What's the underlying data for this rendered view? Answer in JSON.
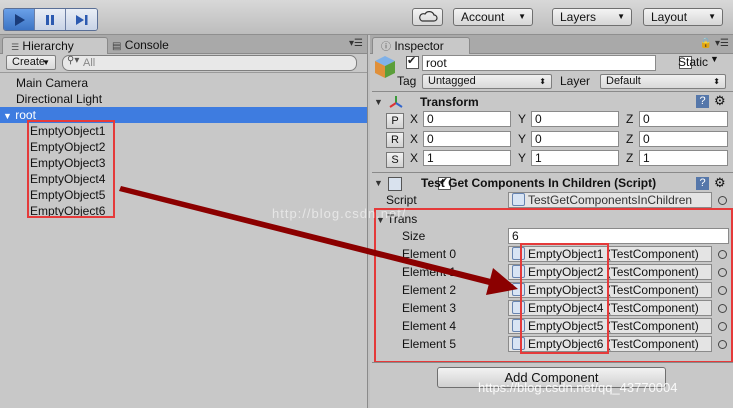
{
  "toolbar": {
    "cloud_icon": "cloud-icon",
    "account_label": "Account",
    "layers_label": "Layers",
    "layout_label": "Layout"
  },
  "hierarchy": {
    "tab_label": "Hierarchy",
    "create_label": "Create",
    "search_placeholder": "All",
    "items": [
      "Main Camera",
      "Directional Light"
    ],
    "root_label": "root",
    "children": [
      "EmptyObject1",
      "EmptyObject2",
      "EmptyObject3",
      "EmptyObject4",
      "EmptyObject5",
      "EmptyObject6"
    ]
  },
  "console": {
    "tab_label": "Console"
  },
  "inspector": {
    "tab_label": "Inspector",
    "object_name": "root",
    "static_label": "Static",
    "tag_label": "Tag",
    "tag_value": "Untagged",
    "layer_label": "Layer",
    "layer_value": "Default",
    "transform": {
      "title": "Transform",
      "rows": [
        {
          "btn": "P",
          "x": "0",
          "y": "0",
          "z": "0"
        },
        {
          "btn": "R",
          "x": "0",
          "y": "0",
          "z": "0"
        },
        {
          "btn": "S",
          "x": "1",
          "y": "1",
          "z": "1"
        }
      ],
      "x_label": "X",
      "y_label": "Y",
      "z_label": "Z"
    },
    "script_component": {
      "title": "Test Get Components In Children (Script)",
      "script_label": "Script",
      "script_value": "TestGetComponentsInChildren",
      "array_label": "Trans",
      "size_label": "Size",
      "size_value": "6",
      "elements": [
        {
          "label": "Element 0",
          "object": "EmptyObject1",
          "type": "(TestComponent)"
        },
        {
          "label": "Element 1",
          "object": "EmptyObject2",
          "type": "(TestComponent)"
        },
        {
          "label": "Element 2",
          "object": "EmptyObject3",
          "type": "(TestComponent)"
        },
        {
          "label": "Element 3",
          "object": "EmptyObject4",
          "type": "(TestComponent)"
        },
        {
          "label": "Element 4",
          "object": "EmptyObject5",
          "type": "(TestComponent)"
        },
        {
          "label": "Element 5",
          "object": "EmptyObject6",
          "type": "(TestComponent)"
        }
      ]
    },
    "add_component_label": "Add Component"
  },
  "watermarks": {
    "center": "http://blog.csdn.net/",
    "bottom": "https://blog.csdn.net/qq_43770004"
  },
  "colors": {
    "selection": "#3e7ce0",
    "highlight_box": "#e53a3a",
    "arrow": "#8b0000"
  }
}
